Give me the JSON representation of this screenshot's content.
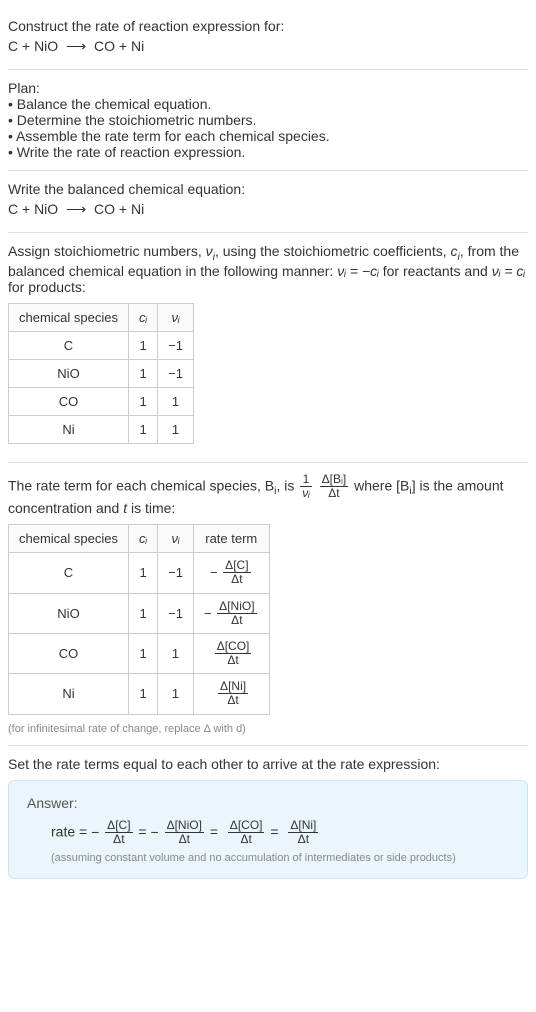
{
  "header": {
    "title": "Construct the rate of reaction expression for:",
    "equation_left": "C + NiO",
    "equation_arrow": "⟶",
    "equation_right": "CO + Ni"
  },
  "plan": {
    "title": "Plan:",
    "items": [
      "Balance the chemical equation.",
      "Determine the stoichiometric numbers.",
      "Assemble the rate term for each chemical species.",
      "Write the rate of reaction expression."
    ]
  },
  "balanced": {
    "title": "Write the balanced chemical equation:",
    "equation_left": "C + NiO",
    "equation_arrow": "⟶",
    "equation_right": "CO + Ni"
  },
  "stoich": {
    "intro_a": "Assign stoichiometric numbers, ",
    "nu_i": "ν",
    "nu_sub": "i",
    "intro_b": ", using the stoichiometric coefficients, ",
    "c_i": "c",
    "c_sub": "i",
    "intro_c": ", from the balanced chemical equation in the following manner: ",
    "relation_react": "νᵢ = −cᵢ",
    "intro_d": " for reactants and ",
    "relation_prod": "νᵢ = cᵢ",
    "intro_e": " for products:",
    "headers": {
      "species": "chemical species",
      "ci": "cᵢ",
      "vi": "νᵢ"
    },
    "rows": [
      {
        "species": "C",
        "ci": "1",
        "vi": "−1"
      },
      {
        "species": "NiO",
        "ci": "1",
        "vi": "−1"
      },
      {
        "species": "CO",
        "ci": "1",
        "vi": "1"
      },
      {
        "species": "Ni",
        "ci": "1",
        "vi": "1"
      }
    ]
  },
  "rateterm": {
    "intro_a": "The rate term for each chemical species, B",
    "intro_sub": "i",
    "intro_b": ", is ",
    "frac1_num": "1",
    "frac1_den": "νᵢ",
    "frac2_num": "Δ[Bᵢ]",
    "frac2_den": "Δt",
    "intro_c": " where [B",
    "intro_d": "] is the amount concentration and ",
    "t": "t",
    "intro_e": " is time:",
    "headers": {
      "species": "chemical species",
      "ci": "cᵢ",
      "vi": "νᵢ",
      "rate": "rate term"
    },
    "rows": [
      {
        "species": "C",
        "ci": "1",
        "vi": "−1",
        "rate_prefix": "−",
        "rate_num": "Δ[C]",
        "rate_den": "Δt"
      },
      {
        "species": "NiO",
        "ci": "1",
        "vi": "−1",
        "rate_prefix": "−",
        "rate_num": "Δ[NiO]",
        "rate_den": "Δt"
      },
      {
        "species": "CO",
        "ci": "1",
        "vi": "1",
        "rate_prefix": "",
        "rate_num": "Δ[CO]",
        "rate_den": "Δt"
      },
      {
        "species": "Ni",
        "ci": "1",
        "vi": "1",
        "rate_prefix": "",
        "rate_num": "Δ[Ni]",
        "rate_den": "Δt"
      }
    ],
    "note": "(for infinitesimal rate of change, replace Δ with d)"
  },
  "final": {
    "title": "Set the rate terms equal to each other to arrive at the rate expression:"
  },
  "answer": {
    "label": "Answer:",
    "rate_label": "rate = ",
    "terms": [
      {
        "prefix": "−",
        "num": "Δ[C]",
        "den": "Δt"
      },
      {
        "prefix": "−",
        "num": "Δ[NiO]",
        "den": "Δt"
      },
      {
        "prefix": "",
        "num": "Δ[CO]",
        "den": "Δt"
      },
      {
        "prefix": "",
        "num": "Δ[Ni]",
        "den": "Δt"
      }
    ],
    "sep": " = ",
    "note": "(assuming constant volume and no accumulation of intermediates or side products)"
  }
}
